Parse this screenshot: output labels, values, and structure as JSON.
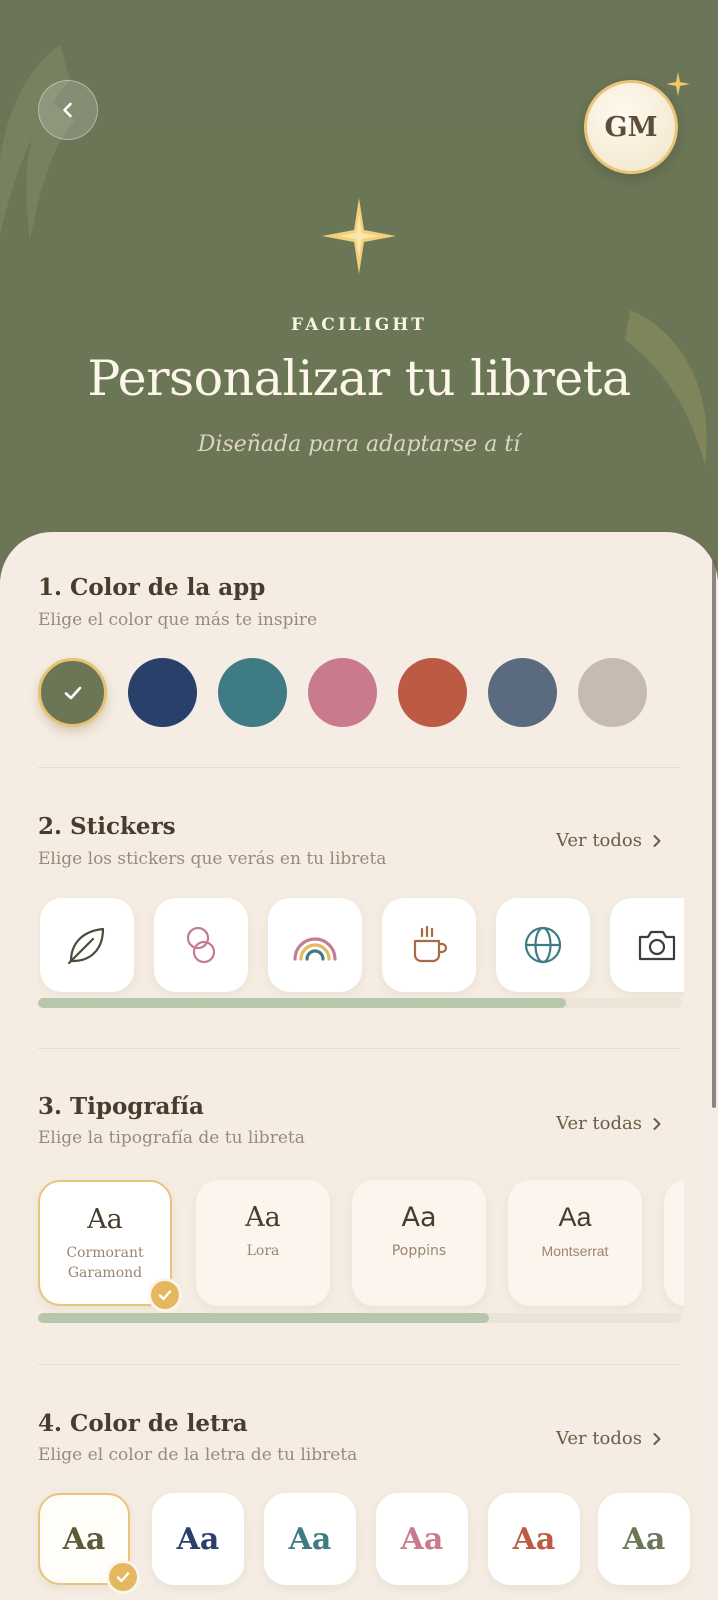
{
  "header": {
    "brand": "FACILIGHT",
    "title": "Personalizar tu libreta",
    "subtitle": "Diseñada para adaptarse a tí",
    "avatar_initials": "GM"
  },
  "sections": {
    "color": {
      "title": "1. Color de la app",
      "subtitle": "Elige el color que más te inspire",
      "swatches": [
        "#6b7656",
        "#28406a",
        "#3f7b84",
        "#c97a8d",
        "#bd5a43",
        "#5a6b80",
        "#c6bbb0"
      ],
      "selected_index": 0
    },
    "stickers": {
      "title": "2. Stickers",
      "subtitle": "Elige los stickers que verás en tu libreta",
      "see_all": "Ver todos",
      "items": [
        "leaf-icon",
        "rings-icon",
        "rainbow-icon",
        "coffee-cup-icon",
        "globe-icon",
        "camera-icon"
      ],
      "scroll_progress": 0.82
    },
    "typography": {
      "title": "3. Tipografía",
      "subtitle": "Elige la tipografía de tu libreta",
      "see_all": "Ver todas",
      "sample": "Aa",
      "fonts": [
        "Cormorant Garamond",
        "Lora",
        "Poppins",
        "Montserrat"
      ],
      "selected_index": 0,
      "scroll_progress": 0.7
    },
    "text_color": {
      "title": "4. Color de letra",
      "subtitle": "Elige el color de la letra de tu libreta",
      "see_all": "Ver todos",
      "sample": "Aa",
      "colors": [
        "#5d5a3a",
        "#28406a",
        "#3f7b84",
        "#c97a8d",
        "#bd5a43",
        "#6b7656"
      ],
      "selected_index": 0
    }
  },
  "colors": {
    "hero_bg": "#6b7656",
    "sheet_bg": "#f5ede3",
    "accent_gold": "#e5b75e",
    "scroll_fill": "#b8c7ab"
  }
}
